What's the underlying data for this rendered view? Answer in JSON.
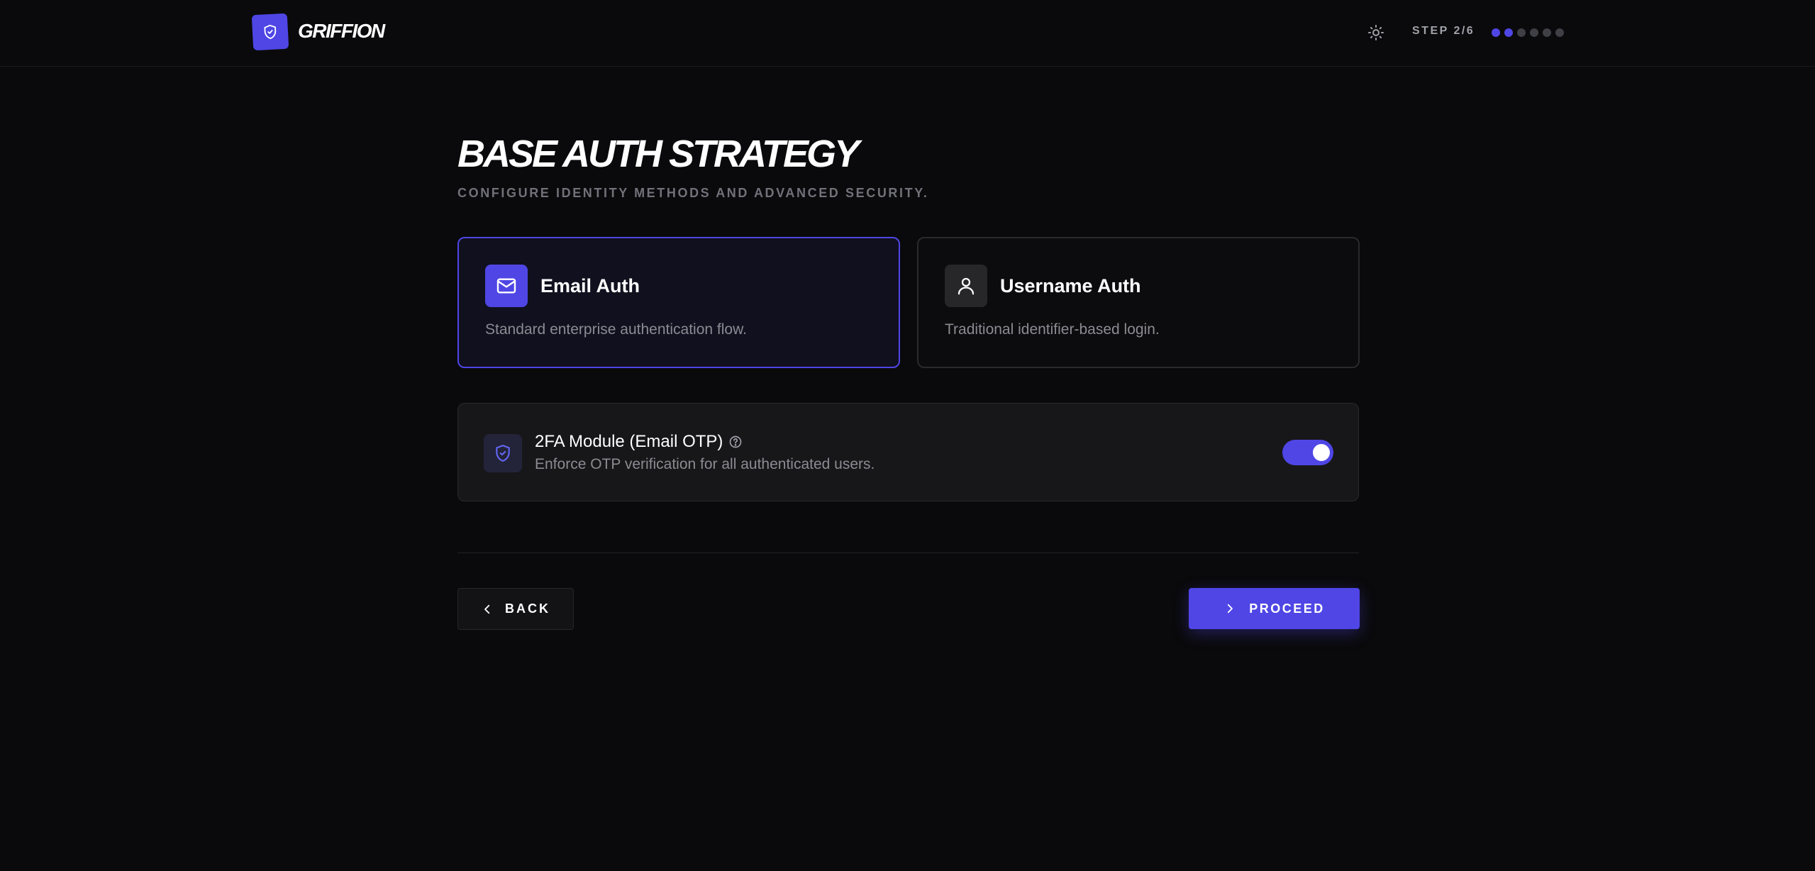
{
  "brand": {
    "name": "GRIFFION",
    "accent_color": "#4f46e5"
  },
  "header": {
    "theme_icon": "sun-icon",
    "step_label": "STEP 2/6",
    "steps_total": 6,
    "steps_completed": 2
  },
  "page": {
    "title": "BASE AUTH STRATEGY",
    "subtitle": "CONFIGURE IDENTITY METHODS AND ADVANCED SECURITY."
  },
  "auth_options": [
    {
      "icon": "mail-icon",
      "title": "Email Auth",
      "description": "Standard enterprise authentication flow.",
      "selected": true
    },
    {
      "icon": "user-icon",
      "title": "Username Auth",
      "description": "Traditional identifier-based login.",
      "selected": false
    }
  ],
  "module": {
    "icon": "shield-check-icon",
    "title": "2FA Module (Email OTP)",
    "help_icon": "help-circle-icon",
    "description": "Enforce OTP verification for all authenticated users.",
    "enabled": true
  },
  "actions": {
    "back_label": "BACK",
    "back_icon": "chevron-left-icon",
    "proceed_label": "PROCEED",
    "proceed_icon": "chevron-right-icon"
  }
}
